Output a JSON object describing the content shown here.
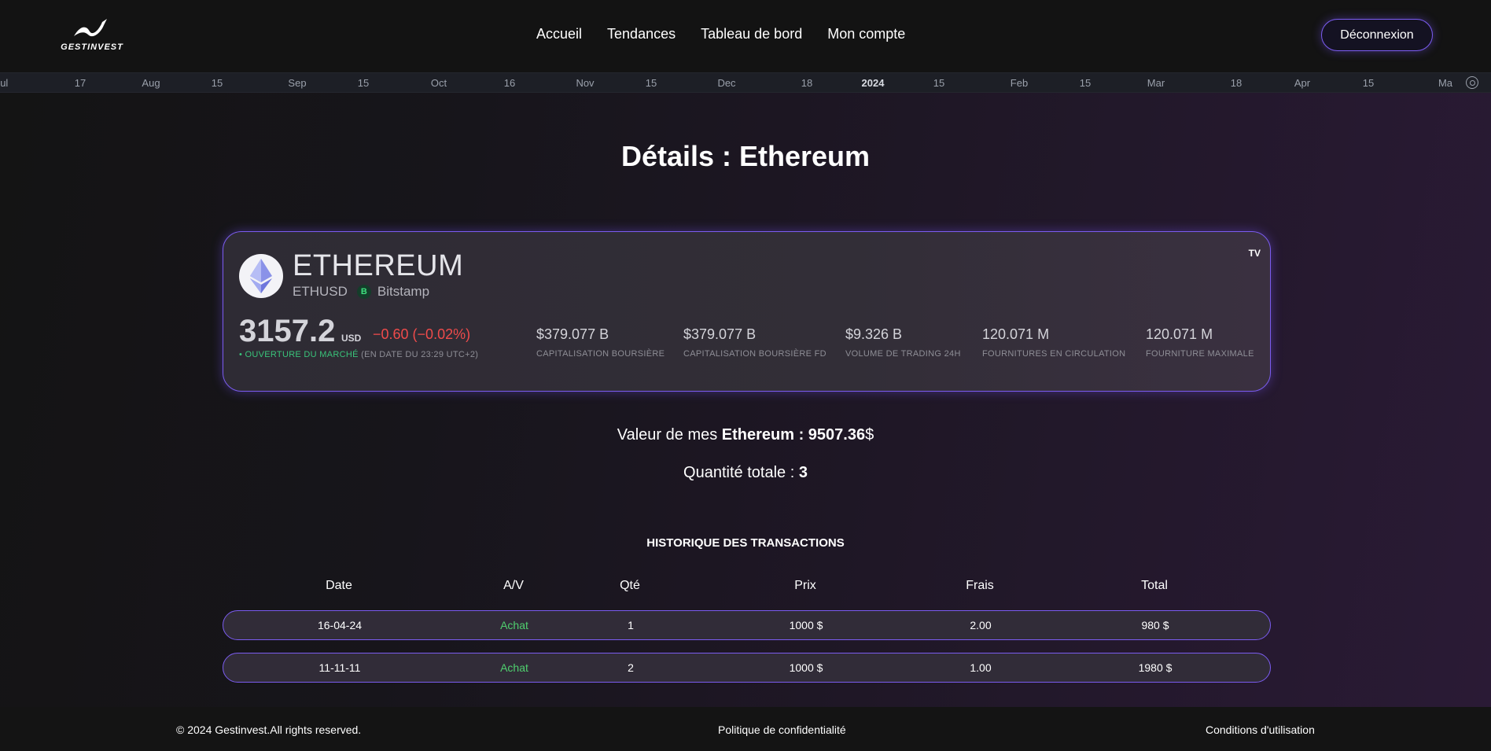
{
  "header": {
    "brand": "GESTINVEST",
    "nav": [
      "Accueil",
      "Tendances",
      "Tableau de bord",
      "Mon compte"
    ],
    "logout": "Déconnexion"
  },
  "timeline": {
    "ticks": [
      "Jul",
      "17",
      "Aug",
      "15",
      "Sep",
      "15",
      "Oct",
      "16",
      "Nov",
      "15",
      "Dec",
      "18",
      "2024",
      "15",
      "Feb",
      "15",
      "Mar",
      "18",
      "Apr",
      "15",
      "Ma"
    ]
  },
  "page": {
    "title": "Détails : Ethereum"
  },
  "widget": {
    "name": "ETHEREUM",
    "symbol": "ETHUSD",
    "exchange_badge": "B",
    "exchange": "Bitstamp",
    "tv_mark": "TV",
    "price": "3157.2",
    "currency": "USD",
    "change": "−0.60  (−0.02%)",
    "market_open": "• OUVERTURE DU MARCHÉ",
    "market_asof": " (EN DATE DU 23:29 UTC+2)",
    "stats": [
      {
        "value": "$379.077 B",
        "label": "CAPITALISATION BOURSIÈRE"
      },
      {
        "value": "$379.077 B",
        "label": "CAPITALISATION BOURSIÈRE FD"
      },
      {
        "value": "$9.326 B",
        "label": "VOLUME DE TRADING 24H"
      },
      {
        "value": "120.071 M",
        "label": "FOURNITURES EN CIRCULATION"
      },
      {
        "value": "120.071 M",
        "label": "FOURNITURE MAXIMALE"
      }
    ]
  },
  "holding": {
    "value_label": "Valeur de mes ",
    "value_strong": "Ethereum : 9507.36",
    "value_suffix": "$",
    "qty_label": "Quantité totale : ",
    "qty": "3"
  },
  "transactions": {
    "title": "HISTORIQUE DES TRANSACTIONS",
    "headers": [
      "Date",
      "A/V",
      "Qté",
      "Prix",
      "Frais",
      "Total"
    ],
    "rows": [
      [
        "16-04-24",
        "Achat",
        "1",
        "1000 $",
        "2.00",
        "980 $"
      ],
      [
        "11-11-11",
        "Achat",
        "2",
        "1000 $",
        "1.00",
        "1980 $"
      ]
    ]
  },
  "footer": {
    "copyright": "© 2024 Gestinvest.All rights reserved.",
    "privacy": "Politique de confidentialité",
    "terms": "Conditions d'utilisation"
  }
}
